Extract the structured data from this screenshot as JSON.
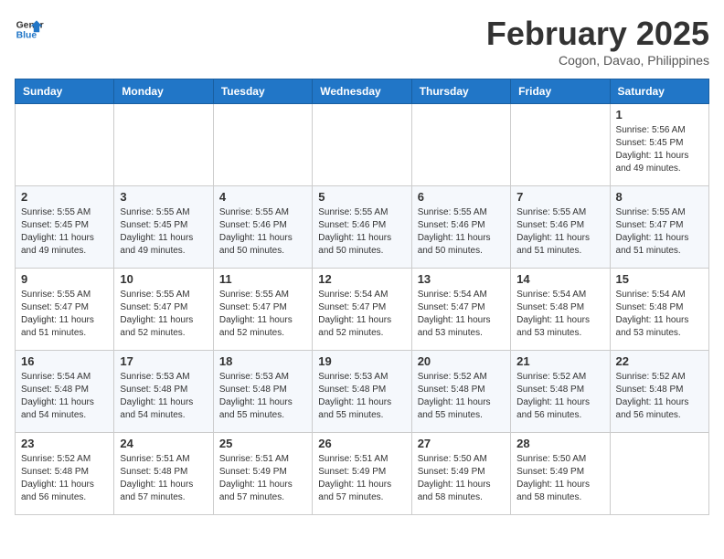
{
  "header": {
    "logo_line1": "General",
    "logo_line2": "Blue",
    "month_year": "February 2025",
    "location": "Cogon, Davao, Philippines"
  },
  "days_of_week": [
    "Sunday",
    "Monday",
    "Tuesday",
    "Wednesday",
    "Thursday",
    "Friday",
    "Saturday"
  ],
  "weeks": [
    [
      {
        "day": "",
        "info": ""
      },
      {
        "day": "",
        "info": ""
      },
      {
        "day": "",
        "info": ""
      },
      {
        "day": "",
        "info": ""
      },
      {
        "day": "",
        "info": ""
      },
      {
        "day": "",
        "info": ""
      },
      {
        "day": "1",
        "info": "Sunrise: 5:56 AM\nSunset: 5:45 PM\nDaylight: 11 hours\nand 49 minutes."
      }
    ],
    [
      {
        "day": "2",
        "info": "Sunrise: 5:55 AM\nSunset: 5:45 PM\nDaylight: 11 hours\nand 49 minutes."
      },
      {
        "day": "3",
        "info": "Sunrise: 5:55 AM\nSunset: 5:45 PM\nDaylight: 11 hours\nand 49 minutes."
      },
      {
        "day": "4",
        "info": "Sunrise: 5:55 AM\nSunset: 5:46 PM\nDaylight: 11 hours\nand 50 minutes."
      },
      {
        "day": "5",
        "info": "Sunrise: 5:55 AM\nSunset: 5:46 PM\nDaylight: 11 hours\nand 50 minutes."
      },
      {
        "day": "6",
        "info": "Sunrise: 5:55 AM\nSunset: 5:46 PM\nDaylight: 11 hours\nand 50 minutes."
      },
      {
        "day": "7",
        "info": "Sunrise: 5:55 AM\nSunset: 5:46 PM\nDaylight: 11 hours\nand 51 minutes."
      },
      {
        "day": "8",
        "info": "Sunrise: 5:55 AM\nSunset: 5:47 PM\nDaylight: 11 hours\nand 51 minutes."
      }
    ],
    [
      {
        "day": "9",
        "info": "Sunrise: 5:55 AM\nSunset: 5:47 PM\nDaylight: 11 hours\nand 51 minutes."
      },
      {
        "day": "10",
        "info": "Sunrise: 5:55 AM\nSunset: 5:47 PM\nDaylight: 11 hours\nand 52 minutes."
      },
      {
        "day": "11",
        "info": "Sunrise: 5:55 AM\nSunset: 5:47 PM\nDaylight: 11 hours\nand 52 minutes."
      },
      {
        "day": "12",
        "info": "Sunrise: 5:54 AM\nSunset: 5:47 PM\nDaylight: 11 hours\nand 52 minutes."
      },
      {
        "day": "13",
        "info": "Sunrise: 5:54 AM\nSunset: 5:47 PM\nDaylight: 11 hours\nand 53 minutes."
      },
      {
        "day": "14",
        "info": "Sunrise: 5:54 AM\nSunset: 5:48 PM\nDaylight: 11 hours\nand 53 minutes."
      },
      {
        "day": "15",
        "info": "Sunrise: 5:54 AM\nSunset: 5:48 PM\nDaylight: 11 hours\nand 53 minutes."
      }
    ],
    [
      {
        "day": "16",
        "info": "Sunrise: 5:54 AM\nSunset: 5:48 PM\nDaylight: 11 hours\nand 54 minutes."
      },
      {
        "day": "17",
        "info": "Sunrise: 5:53 AM\nSunset: 5:48 PM\nDaylight: 11 hours\nand 54 minutes."
      },
      {
        "day": "18",
        "info": "Sunrise: 5:53 AM\nSunset: 5:48 PM\nDaylight: 11 hours\nand 55 minutes."
      },
      {
        "day": "19",
        "info": "Sunrise: 5:53 AM\nSunset: 5:48 PM\nDaylight: 11 hours\nand 55 minutes."
      },
      {
        "day": "20",
        "info": "Sunrise: 5:52 AM\nSunset: 5:48 PM\nDaylight: 11 hours\nand 55 minutes."
      },
      {
        "day": "21",
        "info": "Sunrise: 5:52 AM\nSunset: 5:48 PM\nDaylight: 11 hours\nand 56 minutes."
      },
      {
        "day": "22",
        "info": "Sunrise: 5:52 AM\nSunset: 5:48 PM\nDaylight: 11 hours\nand 56 minutes."
      }
    ],
    [
      {
        "day": "23",
        "info": "Sunrise: 5:52 AM\nSunset: 5:48 PM\nDaylight: 11 hours\nand 56 minutes."
      },
      {
        "day": "24",
        "info": "Sunrise: 5:51 AM\nSunset: 5:48 PM\nDaylight: 11 hours\nand 57 minutes."
      },
      {
        "day": "25",
        "info": "Sunrise: 5:51 AM\nSunset: 5:49 PM\nDaylight: 11 hours\nand 57 minutes."
      },
      {
        "day": "26",
        "info": "Sunrise: 5:51 AM\nSunset: 5:49 PM\nDaylight: 11 hours\nand 57 minutes."
      },
      {
        "day": "27",
        "info": "Sunrise: 5:50 AM\nSunset: 5:49 PM\nDaylight: 11 hours\nand 58 minutes."
      },
      {
        "day": "28",
        "info": "Sunrise: 5:50 AM\nSunset: 5:49 PM\nDaylight: 11 hours\nand 58 minutes."
      },
      {
        "day": "",
        "info": ""
      }
    ]
  ]
}
